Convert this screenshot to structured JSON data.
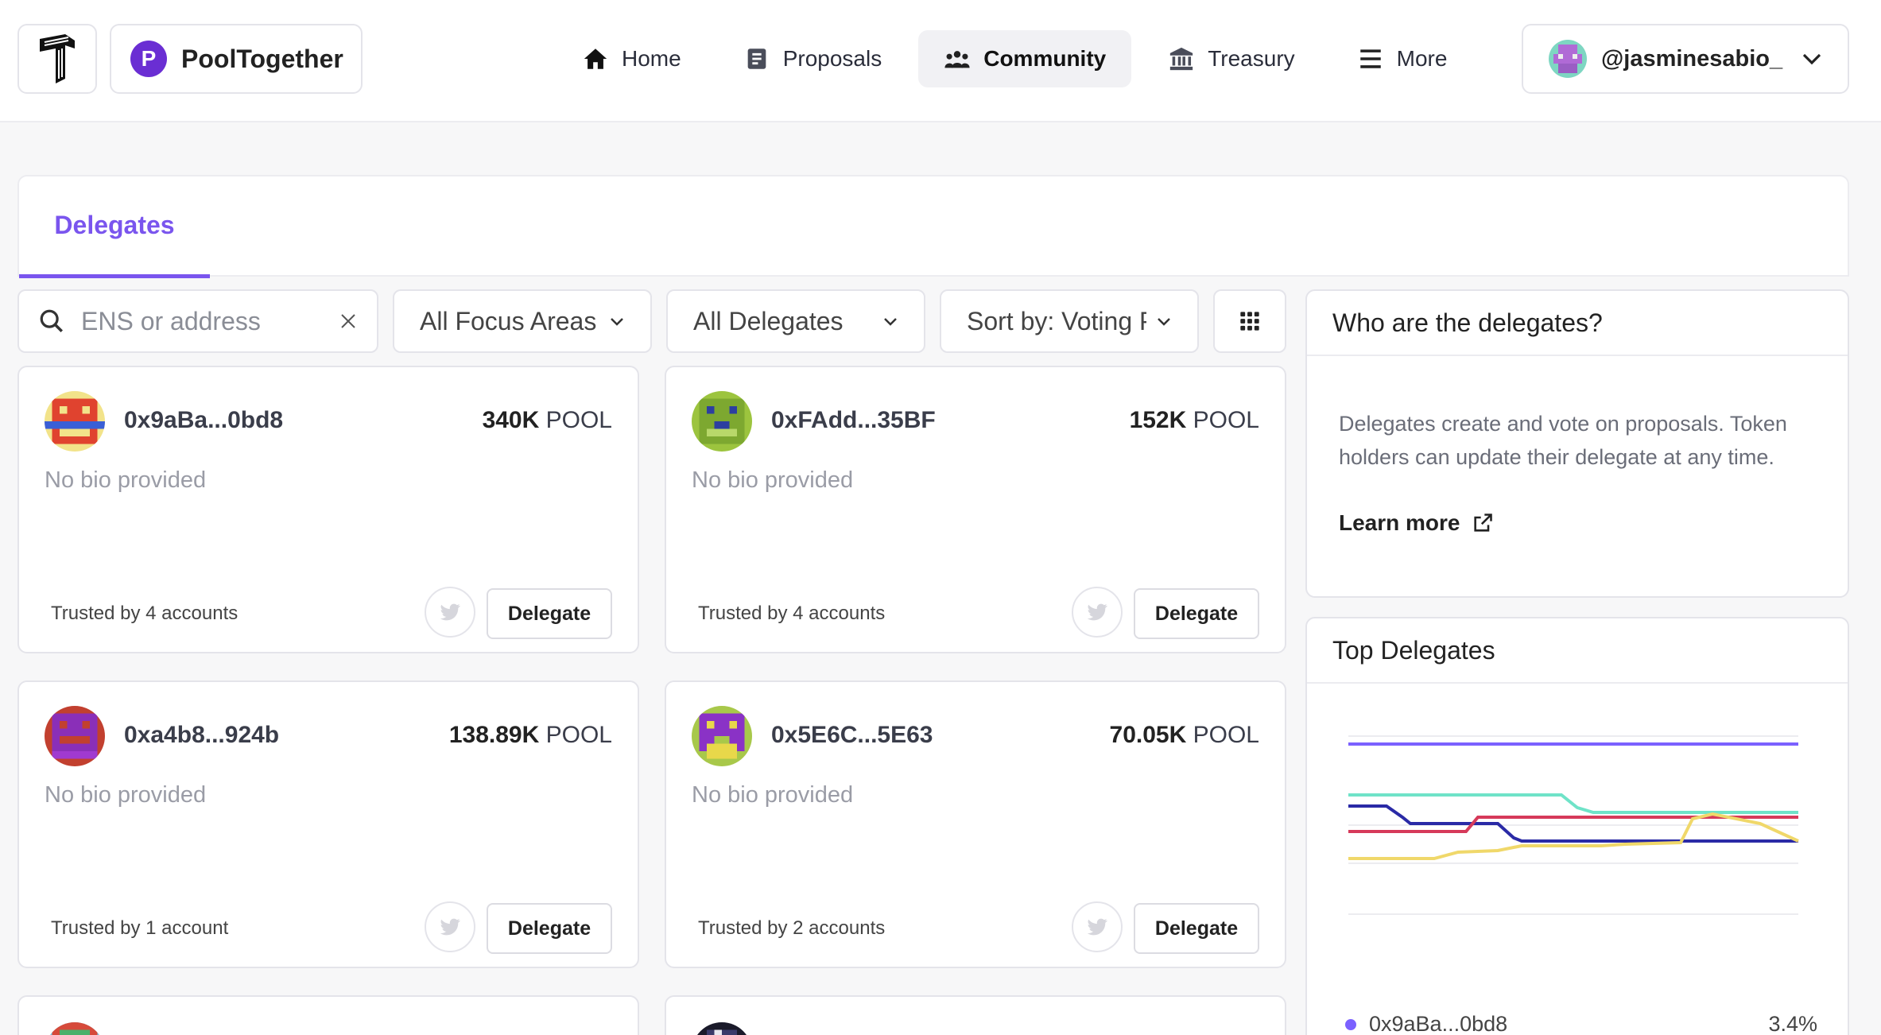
{
  "header": {
    "dao_name": "PoolTogether",
    "nav": [
      {
        "label": "Home",
        "icon": "home-icon"
      },
      {
        "label": "Proposals",
        "icon": "document-icon"
      },
      {
        "label": "Community",
        "icon": "people-icon",
        "active": true
      },
      {
        "label": "Treasury",
        "icon": "bank-icon"
      },
      {
        "label": "More",
        "icon": "hamburger-icon"
      }
    ],
    "user": "@jasminesabio_"
  },
  "tabs": {
    "active": "Delegates"
  },
  "filters": {
    "search_placeholder": "ENS or address",
    "focus_areas": "All Focus Areas",
    "delegates": "All Delegates",
    "sort": "Sort by: Voting Power"
  },
  "delegates": [
    {
      "address": "0x9aBa...0bd8",
      "amount": "340K",
      "unit": "POOL",
      "bio": "No bio provided",
      "trusted": "Trusted by 4 accounts",
      "button": "Delegate"
    },
    {
      "address": "0xFAdd...35BF",
      "amount": "152K",
      "unit": "POOL",
      "bio": "No bio provided",
      "trusted": "Trusted by 4 accounts",
      "button": "Delegate"
    },
    {
      "address": "0xa4b8...924b",
      "amount": "138.89K",
      "unit": "POOL",
      "bio": "No bio provided",
      "trusted": "Trusted by 1 account",
      "button": "Delegate"
    },
    {
      "address": "0x5E6C...5E63",
      "amount": "70.05K",
      "unit": "POOL",
      "bio": "No bio provided",
      "trusted": "Trusted by 2 accounts",
      "button": "Delegate"
    }
  ],
  "info_panel": {
    "title": "Who are the delegates?",
    "text": "Delegates create and vote on proposals. Token holders can update their delegate at any time.",
    "link": "Learn more"
  },
  "top_delegates": {
    "title": "Top Delegates",
    "legend": [
      {
        "name": "0x9aBa...0bd8",
        "pct": "3.4%",
        "color": "#7b61ff"
      }
    ]
  },
  "colors": {
    "accent": "#7a55ee",
    "line_purple": "#7b61ff",
    "line_teal": "#6fe3c8",
    "line_navy": "#2a2aa6",
    "line_red": "#d63a5a",
    "line_yellow": "#f0d86a"
  }
}
